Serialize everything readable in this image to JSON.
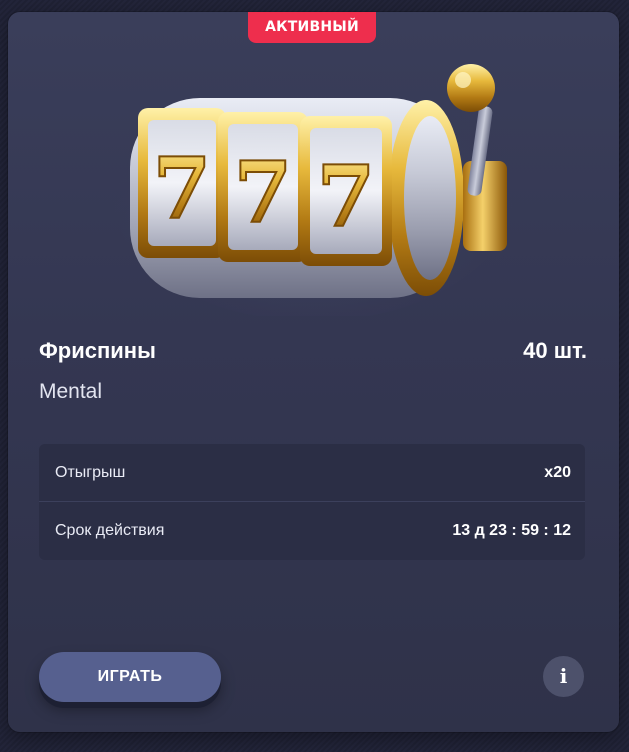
{
  "badge": {
    "label": "АКТИВНЫЙ"
  },
  "bonus": {
    "title": "Фриспины",
    "quantity": "40 шт.",
    "game": "Mental",
    "image_icon": "slot-machine-777-icon"
  },
  "details": [
    {
      "label": "Отыгрыш",
      "value": "x20"
    },
    {
      "label": "Срок действия",
      "value": "13 д 23 : 59 : 12"
    }
  ],
  "actions": {
    "play_label": "ИГРАТЬ",
    "info_label": "i"
  },
  "colors": {
    "badge": "#ee2e4d",
    "button": "#56608f",
    "card": "#343752",
    "gold": "#d9a82b"
  }
}
